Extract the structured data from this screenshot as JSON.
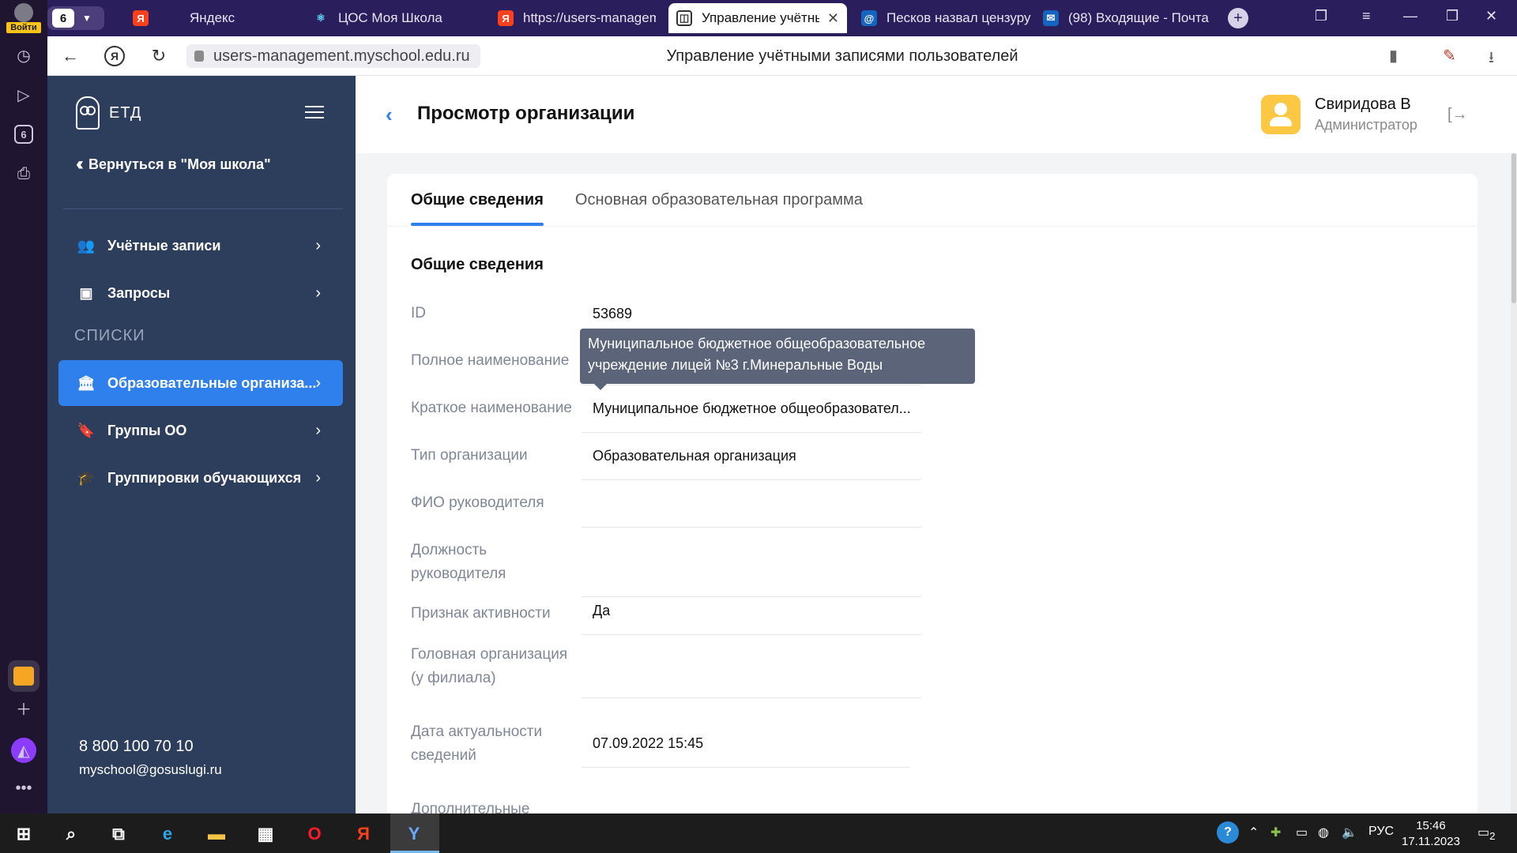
{
  "browser": {
    "rail": {
      "login_label": "Войти",
      "tab_count_badge": "6"
    },
    "tab_counter": "6",
    "tabs": [
      {
        "label": "Яндекс",
        "icon": "yandex-icon",
        "color": "#fc3f1d",
        "glyph": "Я"
      },
      {
        "label": "ЦОС Моя Школа",
        "icon": "react-icon",
        "color": "#61dafb",
        "glyph": "⚛"
      },
      {
        "label": "https://users-manageme",
        "icon": "yandex-icon",
        "color": "#fc3f1d",
        "glyph": "Я"
      },
      {
        "label": "Управление учётным",
        "icon": "eta-icon",
        "color": "#ffffff",
        "glyph": "◫"
      },
      {
        "label": "Песков назвал цензуру",
        "icon": "at-icon",
        "color": "#1565c0",
        "glyph": "@"
      },
      {
        "label": "(98) Входящие - Почта",
        "icon": "mail-icon",
        "color": "#1565c0",
        "glyph": "✉"
      }
    ],
    "url": "users-management.myschool.edu.ru",
    "page_title": "Управление учётными записями пользователей"
  },
  "sidebar": {
    "brand": "ЕТД",
    "back_label": "Вернуться в \"Моя школа\"",
    "section_label": "СПИСКИ",
    "items": [
      {
        "label": "Учётные записи",
        "icon": "users-icon"
      },
      {
        "label": "Запросы",
        "icon": "inbox-icon"
      },
      {
        "label": "Образовательные организа...",
        "icon": "institution-icon"
      },
      {
        "label": "Группы ОО",
        "icon": "bookmark-icon"
      },
      {
        "label": "Группировки обучающихся",
        "icon": "graduation-cap-icon"
      }
    ],
    "phone": "8 800 100 70 10",
    "email": "myschool@gosuslugi.ru"
  },
  "header": {
    "title": "Просмотр организации",
    "user_name": "Свиридова В",
    "user_role": "Администратор"
  },
  "tabs": {
    "general": "Общие сведения",
    "program": "Основная образовательная программа"
  },
  "section_title": "Общие сведения",
  "fields": {
    "id": {
      "label": "ID",
      "value": "53689"
    },
    "full_name": {
      "label": "Полное наименование",
      "value": ""
    },
    "short_name": {
      "label": "Краткое наименование",
      "value": "Муниципальное бюджетное общеобразовател..."
    },
    "org_type": {
      "label": "Тип организации",
      "value": "Образовательная организация"
    },
    "head_name": {
      "label": "ФИО руководителя",
      "value": ""
    },
    "head_position": {
      "label": "Должность руководителя",
      "value": ""
    },
    "active": {
      "label": "Признак активности",
      "value": "Да"
    },
    "parent_org": {
      "label": "Головная организация (у филиала)",
      "value": ""
    },
    "actual_date": {
      "label": "Дата актуальности сведений",
      "value": "07.09.2022 15:45"
    },
    "additional": {
      "label": "Дополнительные"
    }
  },
  "tooltip": "Муниципальное бюджетное общеобразовательное учреждение лицей №3 г.Минеральные Воды",
  "taskbar": {
    "lang": "РУС",
    "time": "15:46",
    "date": "17.11.2023",
    "notifications": "2"
  },
  "colors": {
    "sidebar_bg": "#2d3e5c",
    "accent": "#2f80ed",
    "avatar": "#fcc844",
    "tooltip_bg": "#5b6478"
  }
}
